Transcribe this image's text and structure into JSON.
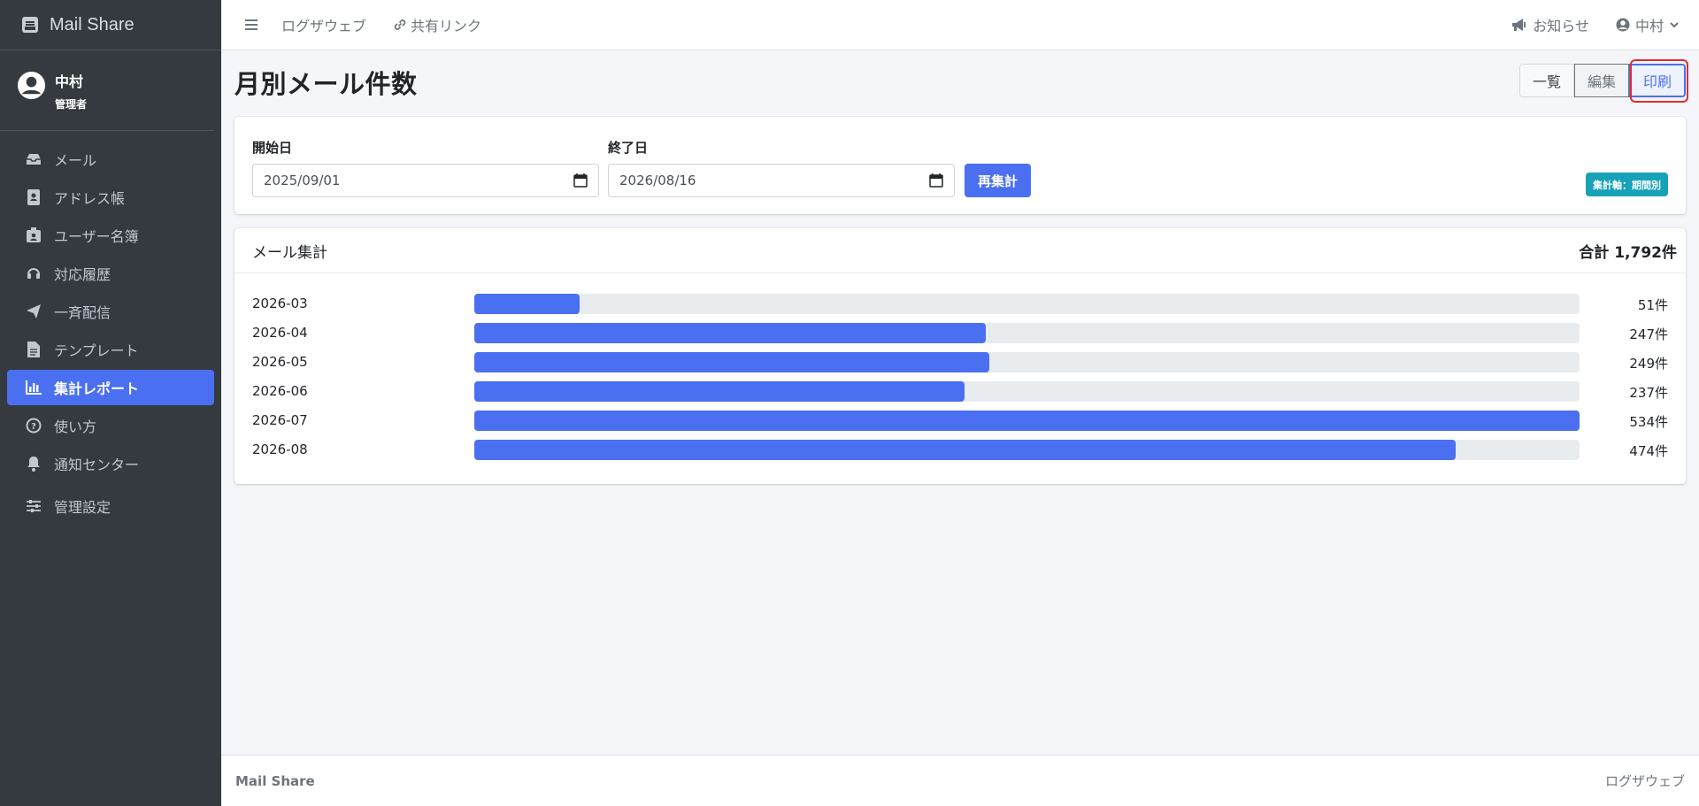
{
  "app": {
    "name": "Mail Share"
  },
  "user": {
    "name": "中村",
    "role": "管理者"
  },
  "sidebar": {
    "items": [
      {
        "label": "メール",
        "icon": "inbox-icon"
      },
      {
        "label": "アドレス帳",
        "icon": "address-book-icon"
      },
      {
        "label": "ユーザー名簿",
        "icon": "id-badge-icon"
      },
      {
        "label": "対応履歴",
        "icon": "headset-icon"
      },
      {
        "label": "一斉配信",
        "icon": "paper-plane-icon"
      },
      {
        "label": "テンプレート",
        "icon": "file-icon"
      },
      {
        "label": "集計レポート",
        "icon": "bar-chart-icon",
        "active": true
      },
      {
        "label": "使い方",
        "icon": "question-circle-icon"
      },
      {
        "label": "通知センター",
        "icon": "bell-icon"
      },
      {
        "label": "管理設定",
        "icon": "sliders-icon"
      }
    ]
  },
  "topbar": {
    "links": [
      "ログザウェブ",
      "共有リンク"
    ],
    "notice": "お知らせ",
    "user": "中村"
  },
  "page": {
    "title": "月別メール件数"
  },
  "view_buttons": {
    "list": "一覧",
    "edit": "編集",
    "print": "印刷"
  },
  "filter": {
    "start_label": "開始日",
    "start_value": "2025/09/01",
    "end_label": "終了日",
    "end_value": "2026/08/16",
    "recalc": "再集計",
    "badge": "集計軸：期間別"
  },
  "summary": {
    "title": "メール集計",
    "total": "合計 1,792件",
    "max": 534,
    "rows": [
      {
        "month": "2026-03",
        "count": 51,
        "label": "51件"
      },
      {
        "month": "2026-04",
        "count": 247,
        "label": "247件"
      },
      {
        "month": "2026-05",
        "count": 249,
        "label": "249件"
      },
      {
        "month": "2026-06",
        "count": 237,
        "label": "237件"
      },
      {
        "month": "2026-07",
        "count": 534,
        "label": "534件"
      },
      {
        "month": "2026-08",
        "count": 474,
        "label": "474件"
      }
    ]
  },
  "footer": {
    "left": "Mail Share",
    "right": "ログザウェブ"
  },
  "colors": {
    "accent": "#4a6ff0",
    "sidebar": "#343a40",
    "badge": "#17a2b8",
    "highlight": "#e22c2c"
  }
}
